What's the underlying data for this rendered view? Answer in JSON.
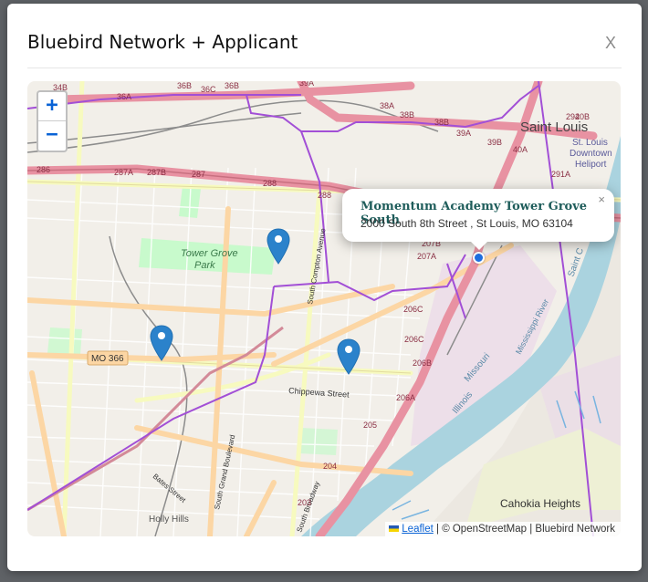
{
  "modal": {
    "title": "Bluebird Network + Applicant",
    "close_label": "X"
  },
  "map": {
    "zoom_in_label": "+",
    "zoom_out_label": "−",
    "markers": [
      "map-marker-icon",
      "map-marker-icon",
      "map-marker-icon"
    ],
    "popup": {
      "name": "Momentum Academy Tower Grove South",
      "address": "2000 South 8th Street , St Louis, MO 63104",
      "close_label": "×"
    },
    "attribution": {
      "leaflet_label": "Leaflet",
      "rest": " | © OpenStreetMap | Bluebird Network"
    },
    "labels": {
      "saint_louis": "Saint Louis",
      "downtown": "St. Louis",
      "downtown2": "Downtown",
      "heliport": "Heliport",
      "tower_grove": "Tower Grove",
      "park": "Park",
      "mo366": "MO 366",
      "chippewa": "Chippewa Street",
      "compton": "South Compton Avenue",
      "grand": "South Grand Boulevard",
      "bates": "Bates Street",
      "holly_hills": "Holly Hills",
      "cahokia": "Cahokia Heights",
      "missouri": "Missouri",
      "illinois": "Illinois",
      "mississippi": "Mississippi River",
      "broadway": "South Broadway",
      "saint_c": "Saint C",
      "exits": [
        "34B",
        "36A",
        "36B",
        "36C",
        "36B",
        "39A",
        "38A",
        "38B",
        "38B",
        "39A",
        "39B",
        "40A",
        "40B",
        "291A",
        "292",
        "286",
        "287A",
        "287B",
        "287",
        "288",
        "288",
        "207B",
        "207A",
        "206C",
        "206C",
        "206B",
        "206A",
        "205",
        "204",
        "203"
      ]
    },
    "colors": {
      "land": "#f2efe9",
      "water": "#aad3df",
      "motorway": "#e892a2",
      "primary": "#fcd6a4",
      "secondary": "#f7fabf",
      "park": "#c8facc",
      "network": "#a24fd6",
      "marker": "#2b82cb"
    }
  }
}
